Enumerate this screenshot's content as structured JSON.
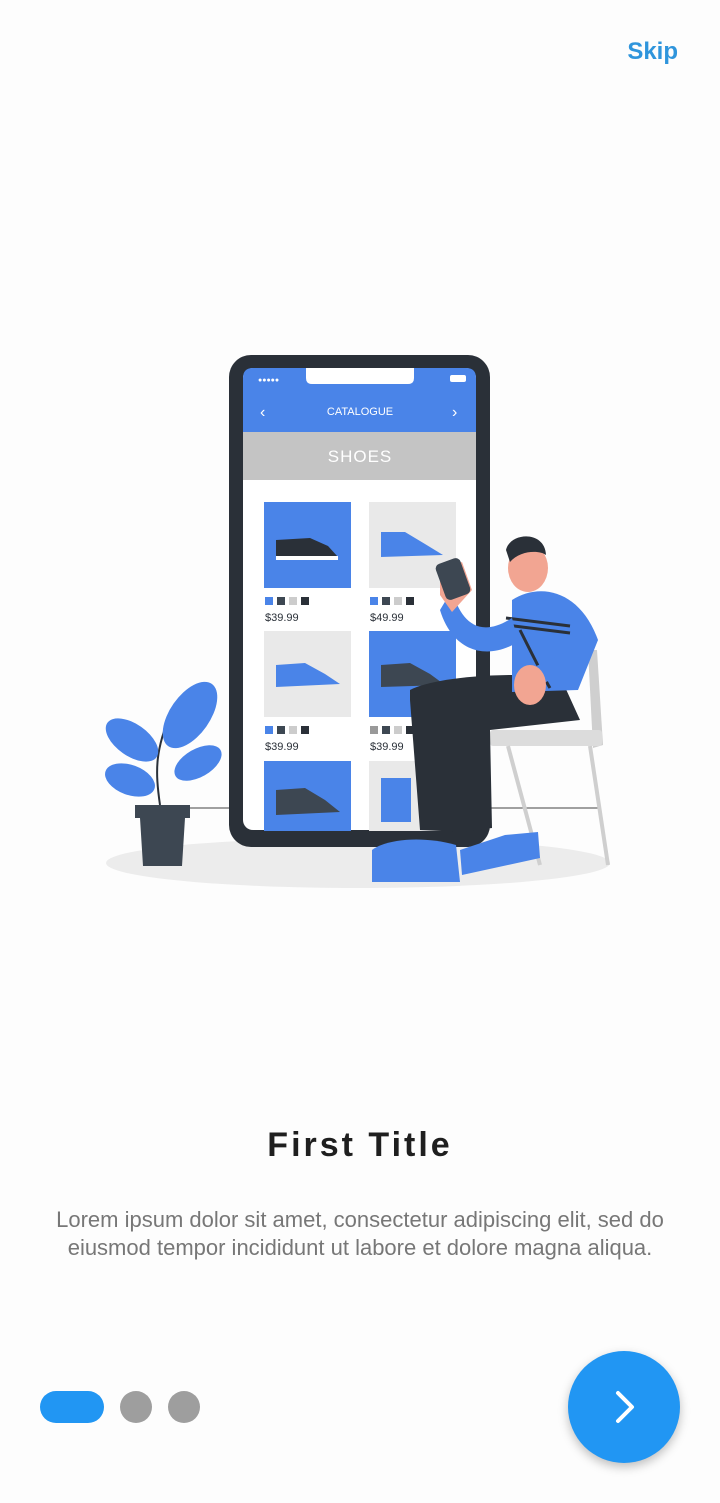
{
  "header": {
    "skip_label": "Skip"
  },
  "illustration": {
    "screen_header": "CATALOGUE",
    "category_label": "SHOES",
    "prices": [
      "$39.99",
      "$49.99",
      "$39.99",
      "$39.99"
    ]
  },
  "content": {
    "title": "First Title",
    "description": "Lorem ipsum dolor sit amet, consectetur adipiscing elit, sed do eiusmod tempor incididunt ut labore et dolore magna aliqua."
  },
  "pagination": {
    "total": 3,
    "active_index": 0
  },
  "next_button": {
    "icon": "chevron-right-icon"
  },
  "colors": {
    "accent": "#2196f3",
    "skip": "#2f95dc",
    "inactive_dot": "#9e9e9e",
    "illustration_blue": "#4a84e8"
  }
}
